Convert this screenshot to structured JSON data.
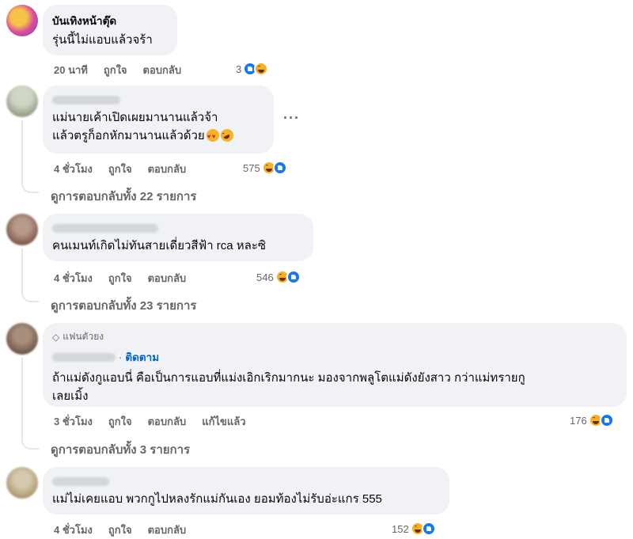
{
  "comments": [
    {
      "author": "บันเทิงหน้าตุ๊ด",
      "text": "รุ่นนี้ไม่แอบแล้วจร้า",
      "time": "20 นาที",
      "like_label": "ถูกใจ",
      "reply_label": "ตอบกลับ",
      "reaction_count": "3",
      "reactions": [
        "like-icon",
        "haha-icon"
      ]
    },
    {
      "author_blurred": true,
      "text_line1": "แม่นายเค้าเปิดเผยมานานแล้วจ้า",
      "text_line2": "แล้วตรูก็อกหักมานานแล้วด้วย",
      "more_label": "···",
      "time": "4 ชั่วโมง",
      "like_label": "ถูกใจ",
      "reply_label": "ตอบกลับ",
      "reaction_count": "575",
      "reactions": [
        "haha-icon",
        "like-icon"
      ],
      "view_replies": "ดูการตอบกลับทั้ง 22 รายการ"
    },
    {
      "author_blurred": true,
      "text": "คนเมนท์เกิดไม่ทันสายเดี่ยวสีฟ้า rca หละซิ",
      "time": "4 ชั่วโมง",
      "like_label": "ถูกใจ",
      "reply_label": "ตอบกลับ",
      "reaction_count": "546",
      "reactions": [
        "haha-icon",
        "like-icon"
      ],
      "view_replies": "ดูการตอบกลับทั้ง 23 รายการ"
    },
    {
      "badge": "แฟนตัวยง",
      "author_blurred": true,
      "follow_label": "ติดตาม",
      "separator": "·",
      "text_line1": "ถ้าแม่ดังกูแอบนี่ คือเป็นการแอบที่แม่งเอิกเริกมากนะ มองจากพลูโตแม่ดังยังสาว กว่าแม่ทรายกู",
      "text_line2": "เลยเมิ้ง",
      "time": "3 ชั่วโมง",
      "like_label": "ถูกใจ",
      "reply_label": "ตอบกลับ",
      "edited_label": "แก้ไขแล้ว",
      "reaction_count": "176",
      "reactions": [
        "haha-icon",
        "like-icon"
      ],
      "view_replies": "ดูการตอบกลับทั้ง 3 รายการ"
    },
    {
      "author_blurred": true,
      "text": "แม่ไม่เคยแอบ พวกกูไปหลงรักแม่กันเอง ยอมท้องไม่รับอ่ะแกร 555",
      "time": "4 ชั่วโมง",
      "like_label": "ถูกใจ",
      "reply_label": "ตอบกลับ",
      "reaction_count": "152",
      "reactions": [
        "haha-icon",
        "like-icon"
      ]
    }
  ],
  "colors": {
    "bubble": "#f0f2f5",
    "secondary_text": "#65676b",
    "link": "#0064d1",
    "like": "#1877f2",
    "haha": "#f7b125"
  }
}
